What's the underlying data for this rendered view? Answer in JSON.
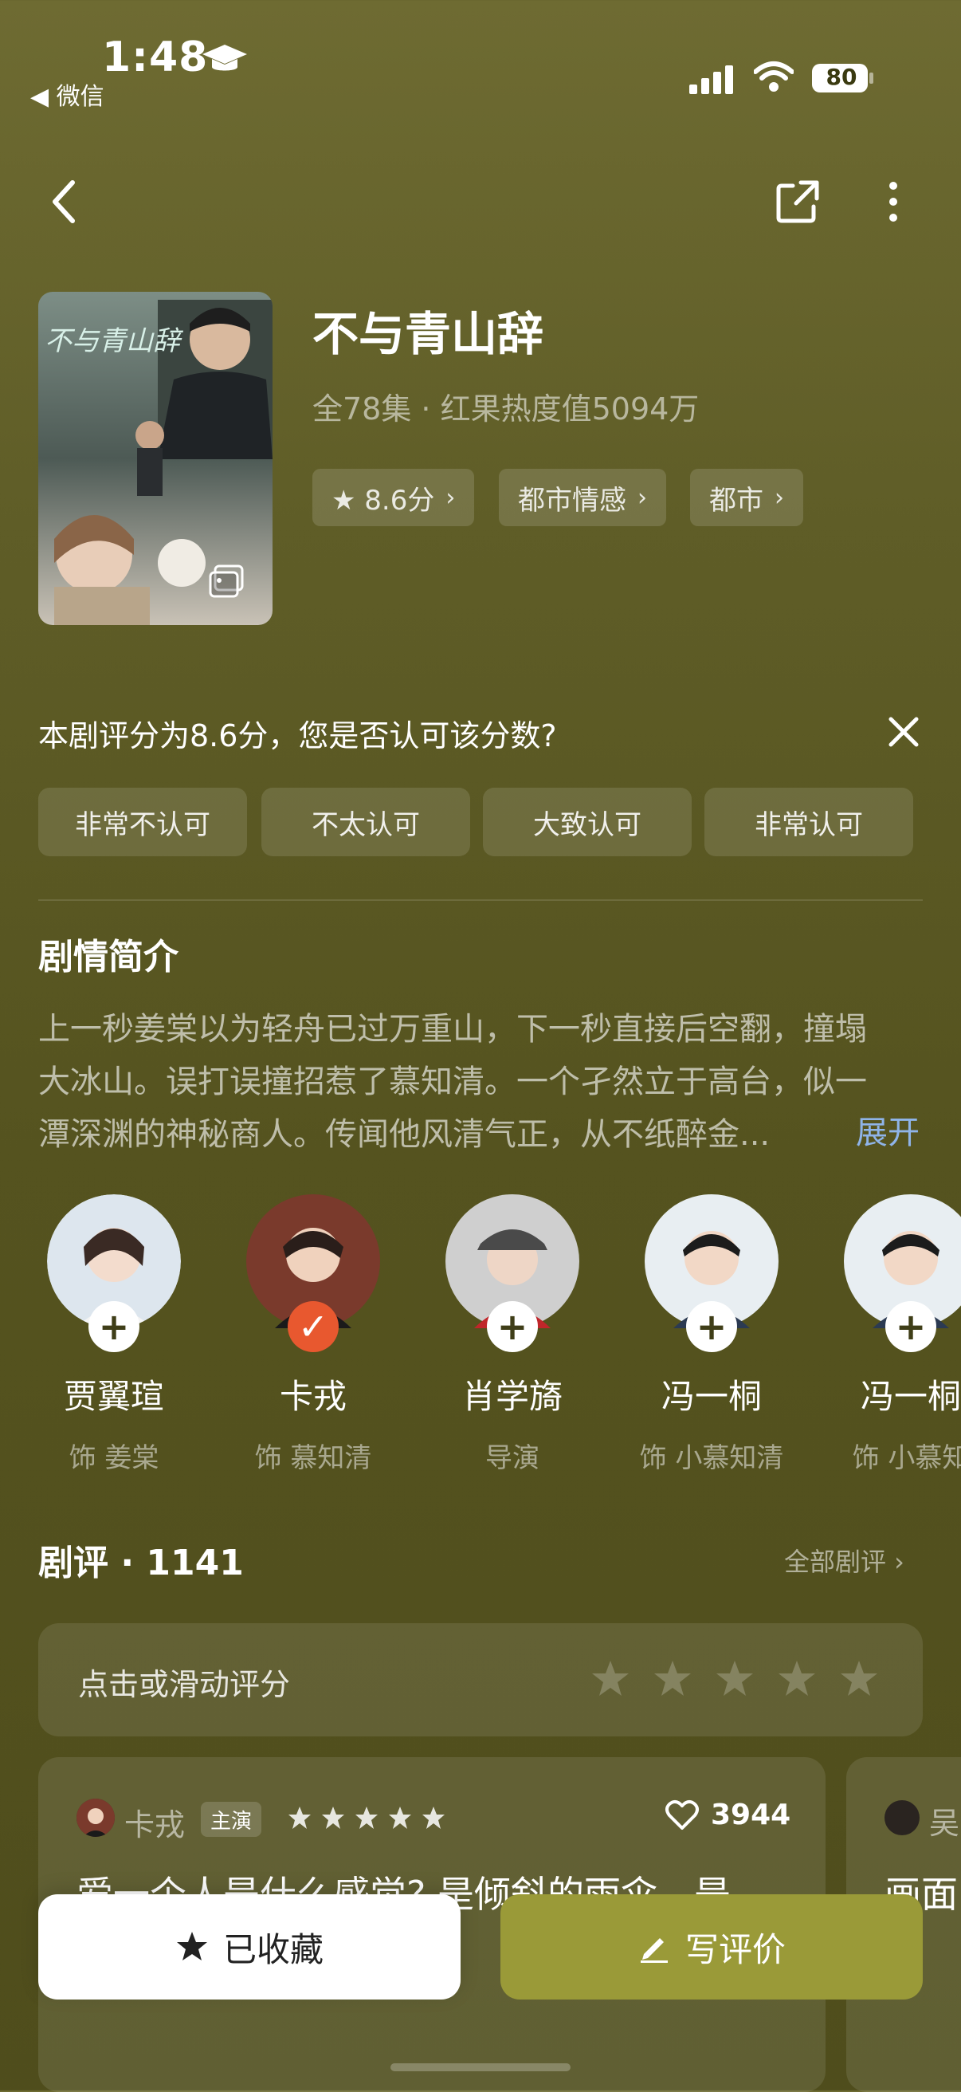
{
  "status_bar": {
    "time": "1:48",
    "back_app": "◀ 微信",
    "battery": "80"
  },
  "header": {
    "title": "不与青山辞",
    "meta": "全78集 · 红果热度值5094万",
    "tags": [
      "★ 8.6分",
      "都市情感",
      "都市"
    ],
    "poster_title": "不与青山辞"
  },
  "rating_question": {
    "text": "本剧评分为8.6分，您是否认可该分数?",
    "options": [
      "非常不认可",
      "不太认可",
      "大致认可",
      "非常认可"
    ]
  },
  "synopsis": {
    "title": "剧情简介",
    "lines": [
      "上一秒姜棠以为轻舟已过万重山，下一秒直接后空翻，撞塌",
      "大冰山。误打误撞招惹了慕知清。一个孑然立于高台，似一",
      "潭深渊的神秘商人。传闻他风清气正，从不纸醉金..."
    ],
    "expand": "展开"
  },
  "cast": [
    {
      "name": "贾翼瑄",
      "role": "饰 姜棠",
      "followed": false
    },
    {
      "name": "卡戎",
      "role": "饰 慕知清",
      "followed": true
    },
    {
      "name": "肖学旖",
      "role": "导演",
      "followed": false
    },
    {
      "name": "冯一桐",
      "role": "饰 小慕知清",
      "followed": false
    },
    {
      "name": "冯一桐",
      "role": "饰 小慕知",
      "followed": false
    }
  ],
  "reviews": {
    "title": "剧评 · 1141",
    "all_link": "全部剧评 ›",
    "rate_prompt": "点击或滑动评分",
    "first": {
      "user": "卡戎",
      "badge": "主演",
      "likes": "3944",
      "text": "爱一个人是什么感觉? 是倾斜的雨伞，是"
    },
    "second": {
      "user": "吴",
      "text": "画面"
    }
  },
  "bottom": {
    "fav_label": "已收藏",
    "write_label": "写评价"
  },
  "colors": {
    "accent_orange": "#e8582f",
    "write_button": "#9a9a38",
    "link_blue": "#8fb4e8"
  }
}
